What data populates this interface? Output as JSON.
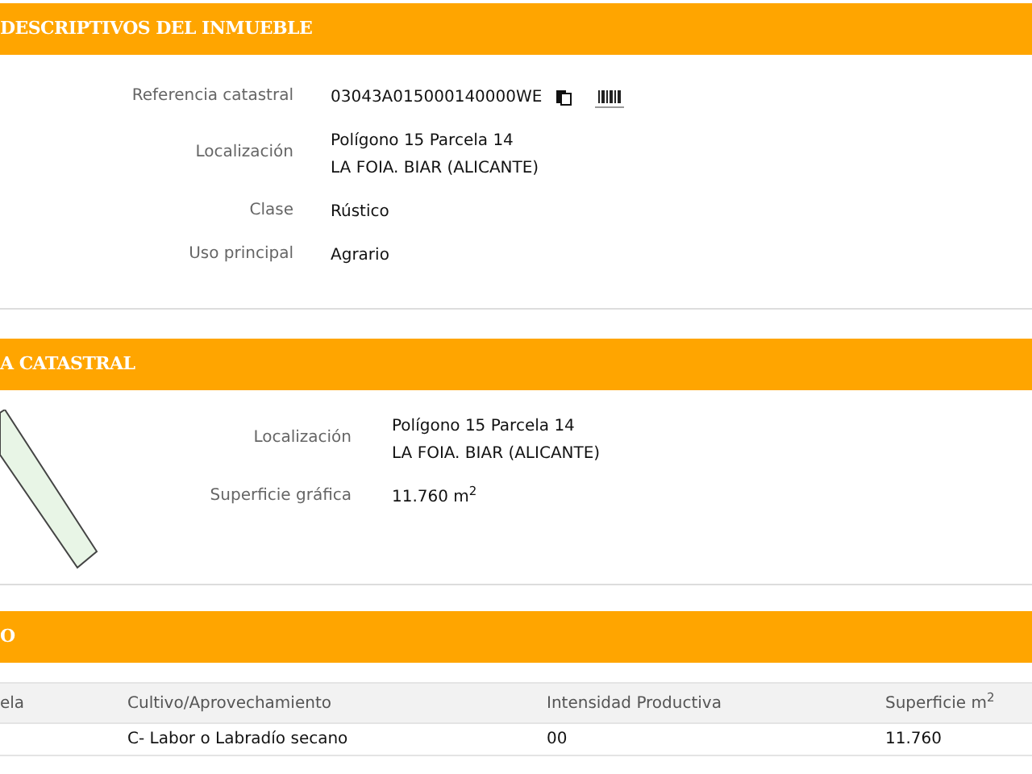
{
  "sections": [
    {
      "title": "DESCRIPTIVOS DEL INMUEBLE",
      "kind": "fields",
      "fields": [
        {
          "label": "Referencia catastral",
          "lines": [
            "03043A015000140000WE"
          ],
          "kind": "reference"
        },
        {
          "label": "Localización",
          "lines": [
            "Polígono 15 Parcela 14",
            "LA FOIA. BIAR (ALICANTE)"
          ],
          "kind": "text"
        },
        {
          "label": "Clase",
          "lines": [
            "Rústico"
          ],
          "kind": "text"
        },
        {
          "label": "Uso principal",
          "lines": [
            "Agrario"
          ],
          "kind": "text"
        }
      ]
    },
    {
      "title": "A CATASTRAL",
      "kind": "map",
      "fields": [
        {
          "label": "Localización",
          "lines": [
            "Polígono 15 Parcela 14",
            "LA FOIA. BIAR (ALICANTE)"
          ],
          "kind": "text"
        },
        {
          "label": "Superficie gráfica",
          "lines": [
            "11.760 m$^{2}$"
          ],
          "kind": "text"
        }
      ]
    },
    {
      "title": "O",
      "kind": "table",
      "table": {
        "columns": [
          "ela",
          "Cultivo/Aprovechamiento",
          "Intensidad Productiva",
          "Superficie m$^{2}$"
        ],
        "rows": [
          [
            "",
            "C- Labor o Labradío secano",
            "00",
            "11.760"
          ]
        ]
      }
    }
  ]
}
